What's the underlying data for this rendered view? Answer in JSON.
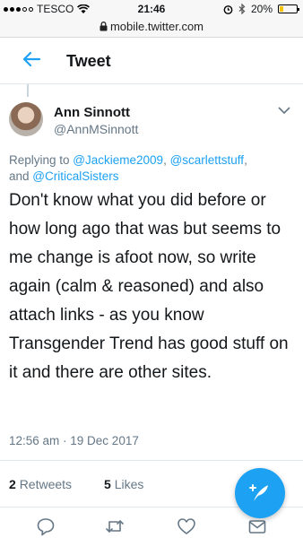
{
  "status_bar": {
    "carrier": "TESCO",
    "time": "21:46",
    "battery": "20%"
  },
  "url_bar": {
    "url": "mobile.twitter.com"
  },
  "header": {
    "title": "Tweet"
  },
  "tweet": {
    "author_name": "Ann Sinnott",
    "author_handle": "@AnnMSinnott",
    "replying_to_prefix": "Replying to ",
    "mention_1": "@Jackieme2009",
    "separator_1": ", ",
    "mention_2": "@scarlettstuff",
    "separator_2": ",",
    "and_label": "and ",
    "mention_3": "@CriticalSisters",
    "text": "Don't know what you did before or how long ago that was but seems to me change is afoot now, so write again (calm & reasoned) and also attach links - as you know Transgender Trend has good stuff on it and there are other sites.",
    "timestamp": "12:56 am · 19 Dec 2017",
    "retweets_count": "2",
    "retweets_label": "Retweets",
    "likes_count": "5",
    "likes_label": "Likes"
  },
  "icons": {
    "back": "arrow-left-icon",
    "caret": "chevron-down-icon",
    "reply": "reply-icon",
    "retweet": "retweet-icon",
    "like": "heart-icon",
    "share": "envelope-icon",
    "compose": "compose-feather-icon"
  },
  "colors": {
    "accent": "#1da1f2",
    "muted": "#657786",
    "battery": "#f5c400"
  }
}
